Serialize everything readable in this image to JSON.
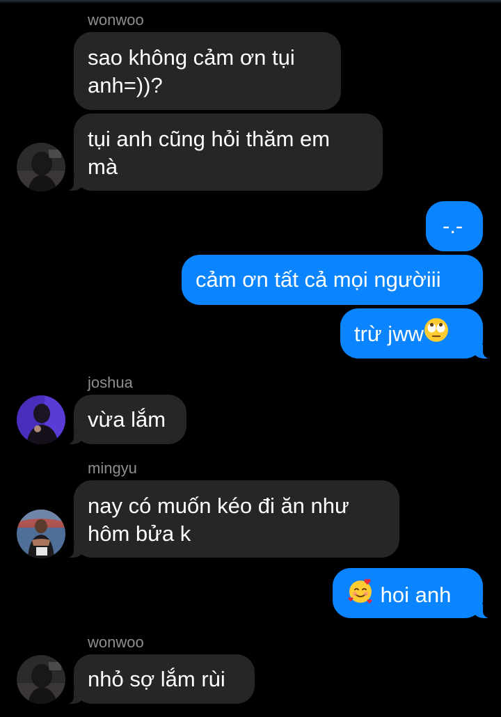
{
  "messages": [
    {
      "sender": "wonwoo",
      "text": "sao không cảm ơn tụi anh=))?"
    },
    {
      "text": "tụi anh cũng hỏi thăm em mà"
    },
    {
      "text": "-.-"
    },
    {
      "text": "cảm ơn tất cả mọi ngườiii"
    },
    {
      "text": "trừ jww",
      "emoji": "face-with-rolling-eyes-emoji"
    },
    {
      "sender": "joshua",
      "text": "vừa lắm"
    },
    {
      "sender": "mingyu",
      "text": "nay có muốn kéo đi ăn như hôm bửa k"
    },
    {
      "text": "hoi anh",
      "emoji": "smiling-face-with-hearts-emoji"
    },
    {
      "sender": "wonwoo",
      "text": "nhỏ sợ lắm rùi"
    }
  ],
  "lines": {
    "m0a": "sao không cảm ơn tụi",
    "m0b": "anh=))?",
    "m1a": "tụi anh cũng hỏi thăm em",
    "m1b": "mà",
    "m6a": "nay có muốn kéo đi ăn như",
    "m6b": "hôm bửa k"
  },
  "colors": {
    "incoming_bubble": "#262628",
    "outgoing_bubble": "#0a84ff",
    "sender_name": "#8e8e93",
    "background": "#000000"
  }
}
